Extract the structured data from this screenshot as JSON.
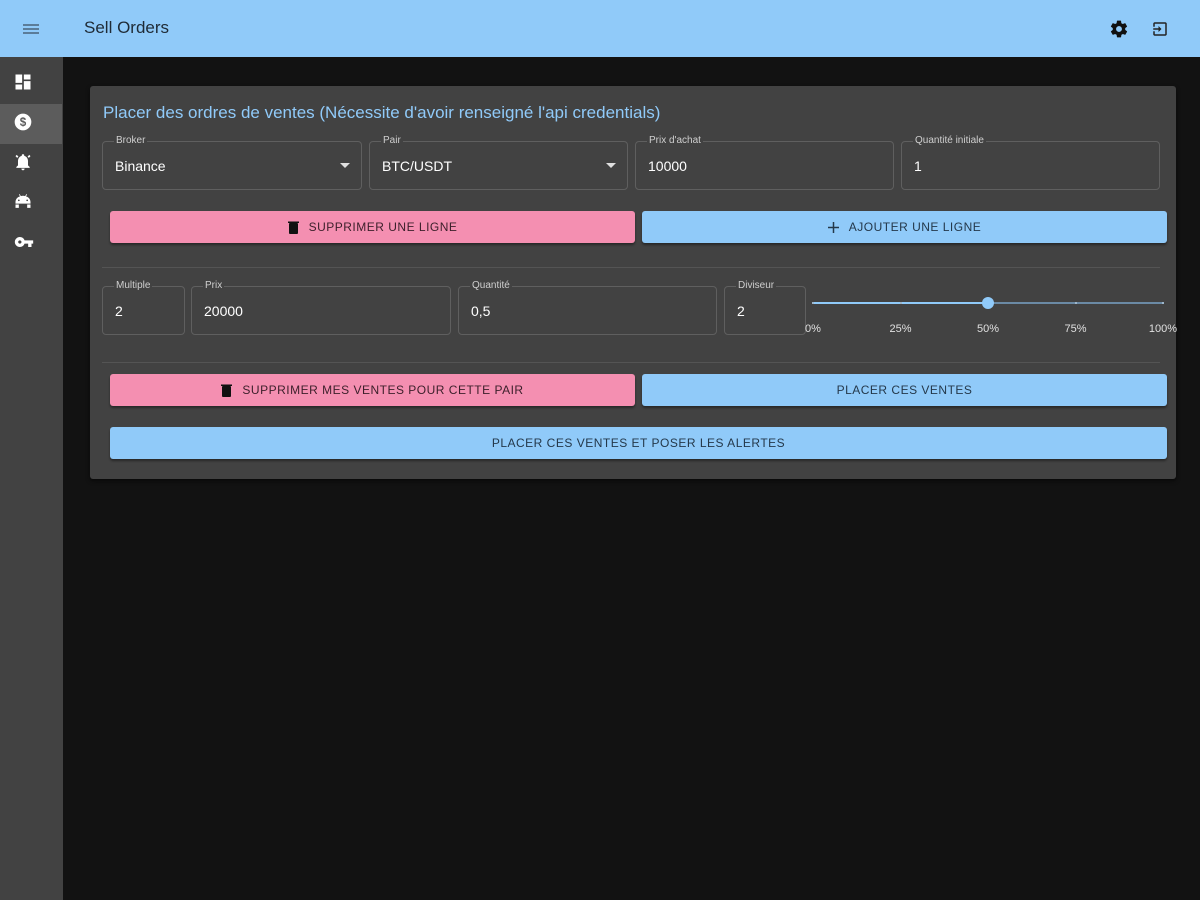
{
  "appbar": {
    "title": "Sell Orders",
    "menu_icon": "menu-icon",
    "settings_icon": "gear-icon",
    "logout_icon": "logout-icon"
  },
  "sidebar": {
    "items": [
      {
        "icon": "dashboard-icon",
        "active": false
      },
      {
        "icon": "dollar-icon",
        "active": true
      },
      {
        "icon": "alarm-icon",
        "active": false
      },
      {
        "icon": "robot-icon",
        "active": false
      },
      {
        "icon": "key-icon",
        "active": false
      }
    ]
  },
  "card": {
    "title": "Placer des ordres de ventes (Nécessite d'avoir renseigné l'api credentials)",
    "broker": {
      "label": "Broker",
      "value": "Binance"
    },
    "pair": {
      "label": "Pair",
      "value": "BTC/USDT"
    },
    "buy_price": {
      "label": "Prix d'achat",
      "value": "10000"
    },
    "initial_qty": {
      "label": "Quantité initiale",
      "value": "1"
    },
    "delete_line_label": "SUPPRIMER UNE LIGNE",
    "add_line_label": "AJOUTER UNE LIGNE",
    "row": {
      "multiple": {
        "label": "Multiple",
        "value": "2"
      },
      "price": {
        "label": "Prix",
        "value": "20000"
      },
      "quantity": {
        "label": "Quantité",
        "value": "0,5"
      },
      "divisor": {
        "label": "Diviseur",
        "value": "2"
      },
      "slider": {
        "value_percent": 50,
        "marks": [
          "0%",
          "25%",
          "50%",
          "75%",
          "100%"
        ]
      }
    },
    "delete_sales_label": "SUPPRIMER MES VENTES POUR CETTE PAIR",
    "place_sales_label": "PLACER CES VENTES",
    "place_sales_alerts_label": "PLACER CES VENTES ET POSER LES ALERTES"
  },
  "colors": {
    "primary": "#90caf9",
    "secondary": "#f48fb1",
    "background": "#121212",
    "surface": "#424242"
  }
}
